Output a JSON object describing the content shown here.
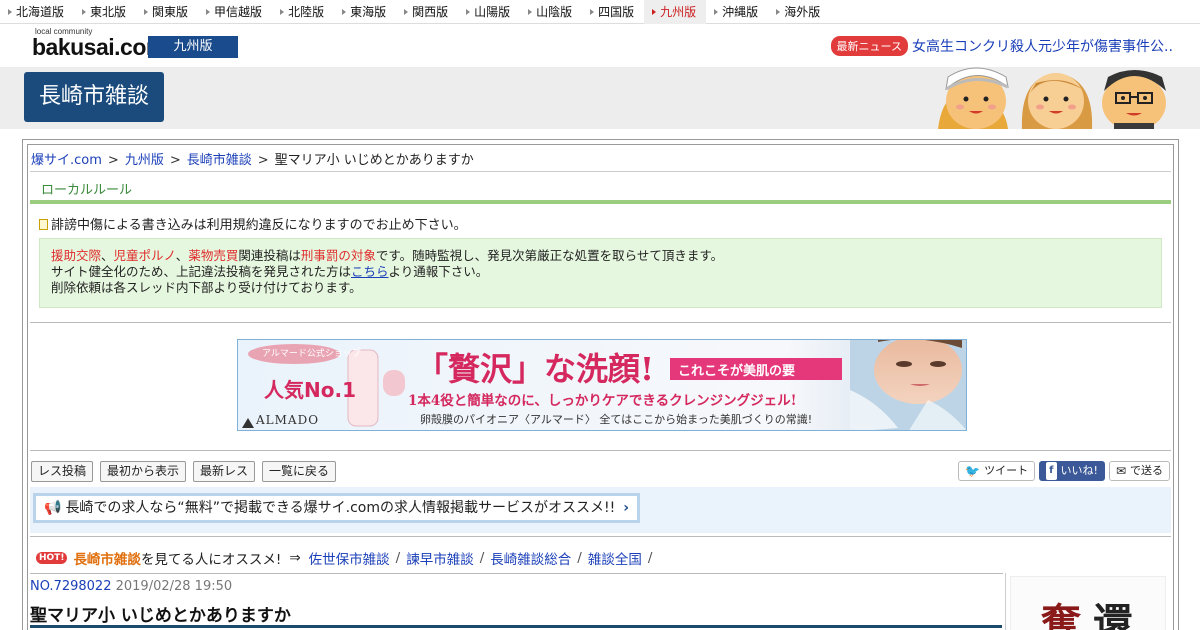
{
  "regions": [
    {
      "label": "北海道版",
      "active": false
    },
    {
      "label": "東北版",
      "active": false
    },
    {
      "label": "関東版",
      "active": false
    },
    {
      "label": "甲信越版",
      "active": false
    },
    {
      "label": "北陸版",
      "active": false
    },
    {
      "label": "東海版",
      "active": false
    },
    {
      "label": "関西版",
      "active": false
    },
    {
      "label": "山陽版",
      "active": false
    },
    {
      "label": "山陰版",
      "active": false
    },
    {
      "label": "四国版",
      "active": false
    },
    {
      "label": "九州版",
      "active": true
    },
    {
      "label": "沖縄版",
      "active": false
    },
    {
      "label": "海外版",
      "active": false
    }
  ],
  "brand": {
    "tagline": "local community",
    "logo": "bakusai.com",
    "edition": "九州版"
  },
  "news": {
    "badge": "最新ニュース",
    "headline": "女高生コンクリ殺人元少年が傷害事件公..."
  },
  "board": {
    "title": "長崎市雑談"
  },
  "breadcrumb": {
    "items": [
      "爆サイ.com",
      "九州版",
      "長崎市雑談"
    ],
    "current": "聖マリア小 いじめとかありますか",
    "sep": ">"
  },
  "local_rule": {
    "heading": "ローカルルール"
  },
  "notice": "誹謗中傷による書き込みは利用規約違反になりますのでお止め下さい。",
  "warning": {
    "w1": "援助交際",
    "c1": "、",
    "w2": "児童ポルノ",
    "c2": "、",
    "w3": "薬物売買",
    "mid": "関連投稿は",
    "w4": "刑事罰の対象",
    "tail": "です。随時監視し、発見次第厳正な処置を取らせて頂きます。",
    "line2_pre": "サイト健全化のため、上記違法投稿を発見された方は",
    "line2_link": "こちら",
    "line2_post": "より通報下さい。",
    "line3": "削除依頼は各スレッド内下部より受け付けております。"
  },
  "ad": {
    "shop_badge": "アルマード公式ショップ",
    "rank": "人気No.1",
    "brand": "ALMADO",
    "headline_q1": "「",
    "headline_word": "贅沢",
    "headline_q2": "」な",
    "headline_tail": "洗顔!",
    "ribbon": "これこそが美肌の要",
    "sub": "1本4役と簡単なのに、しっかりケアできるクレンジングジェル!",
    "foot": "卵殻膜のパイオニア〈アルマード〉 全てはここから始まった美肌づくりの常識!"
  },
  "tools": [
    "レス投稿",
    "最初から表示",
    "最新レス",
    "一覧に戻る"
  ],
  "share": {
    "tweet": "ツイート",
    "like": "いいね!",
    "send": "で送る"
  },
  "promo": {
    "text": "長崎での求人なら“無料”で掲載できる爆サイ.comの求人情報掲載サービスがオススメ!!"
  },
  "related": {
    "hot": "HOT!",
    "board": "長崎市雑談",
    "lead": "を見てる人にオススメ!",
    "arrow": "⇒",
    "links": [
      "佐世保市雑談",
      "諫早市雑談",
      "長崎雑談総合",
      "雑談全国"
    ]
  },
  "post": {
    "number": "NO.7298022",
    "date": "2019/02/28 19:50",
    "title": "聖マリア小 いじめとかありますか"
  },
  "side_ad": {
    "k1": "奪",
    "k2": "還"
  },
  "colors": {
    "accent": "#1a4b8c",
    "warn_red": "#e02b2b",
    "rule_green": "#9acd80",
    "hot_red": "#e23b3b"
  }
}
